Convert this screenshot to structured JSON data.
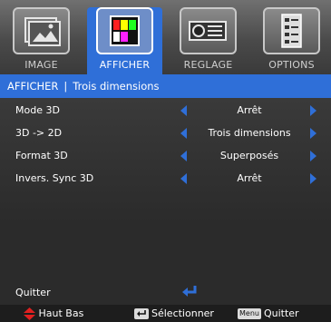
{
  "tabs": [
    {
      "label": "IMAGE"
    },
    {
      "label": "AFFICHER"
    },
    {
      "label": "REGLAGE"
    },
    {
      "label": "OPTIONS"
    }
  ],
  "title": {
    "section": "AFFICHER",
    "separator": "|",
    "page": "Trois dimensions"
  },
  "settings": [
    {
      "label": "Mode 3D",
      "value": "Arrêt"
    },
    {
      "label": "3D -> 2D",
      "value": "Trois dimensions"
    },
    {
      "label": "Format 3D",
      "value": "Superposés"
    },
    {
      "label": "Invers. Sync 3D",
      "value": "Arrêt"
    }
  ],
  "quit_label": "Quitter",
  "footer": {
    "nav_label": "Haut Bas",
    "select_label": "Sélectionner",
    "menu_key": "Menu",
    "quit_label": "Quitter"
  },
  "colors": {
    "accent": "#2f6fd8",
    "nav_arrow": "#e02020"
  }
}
